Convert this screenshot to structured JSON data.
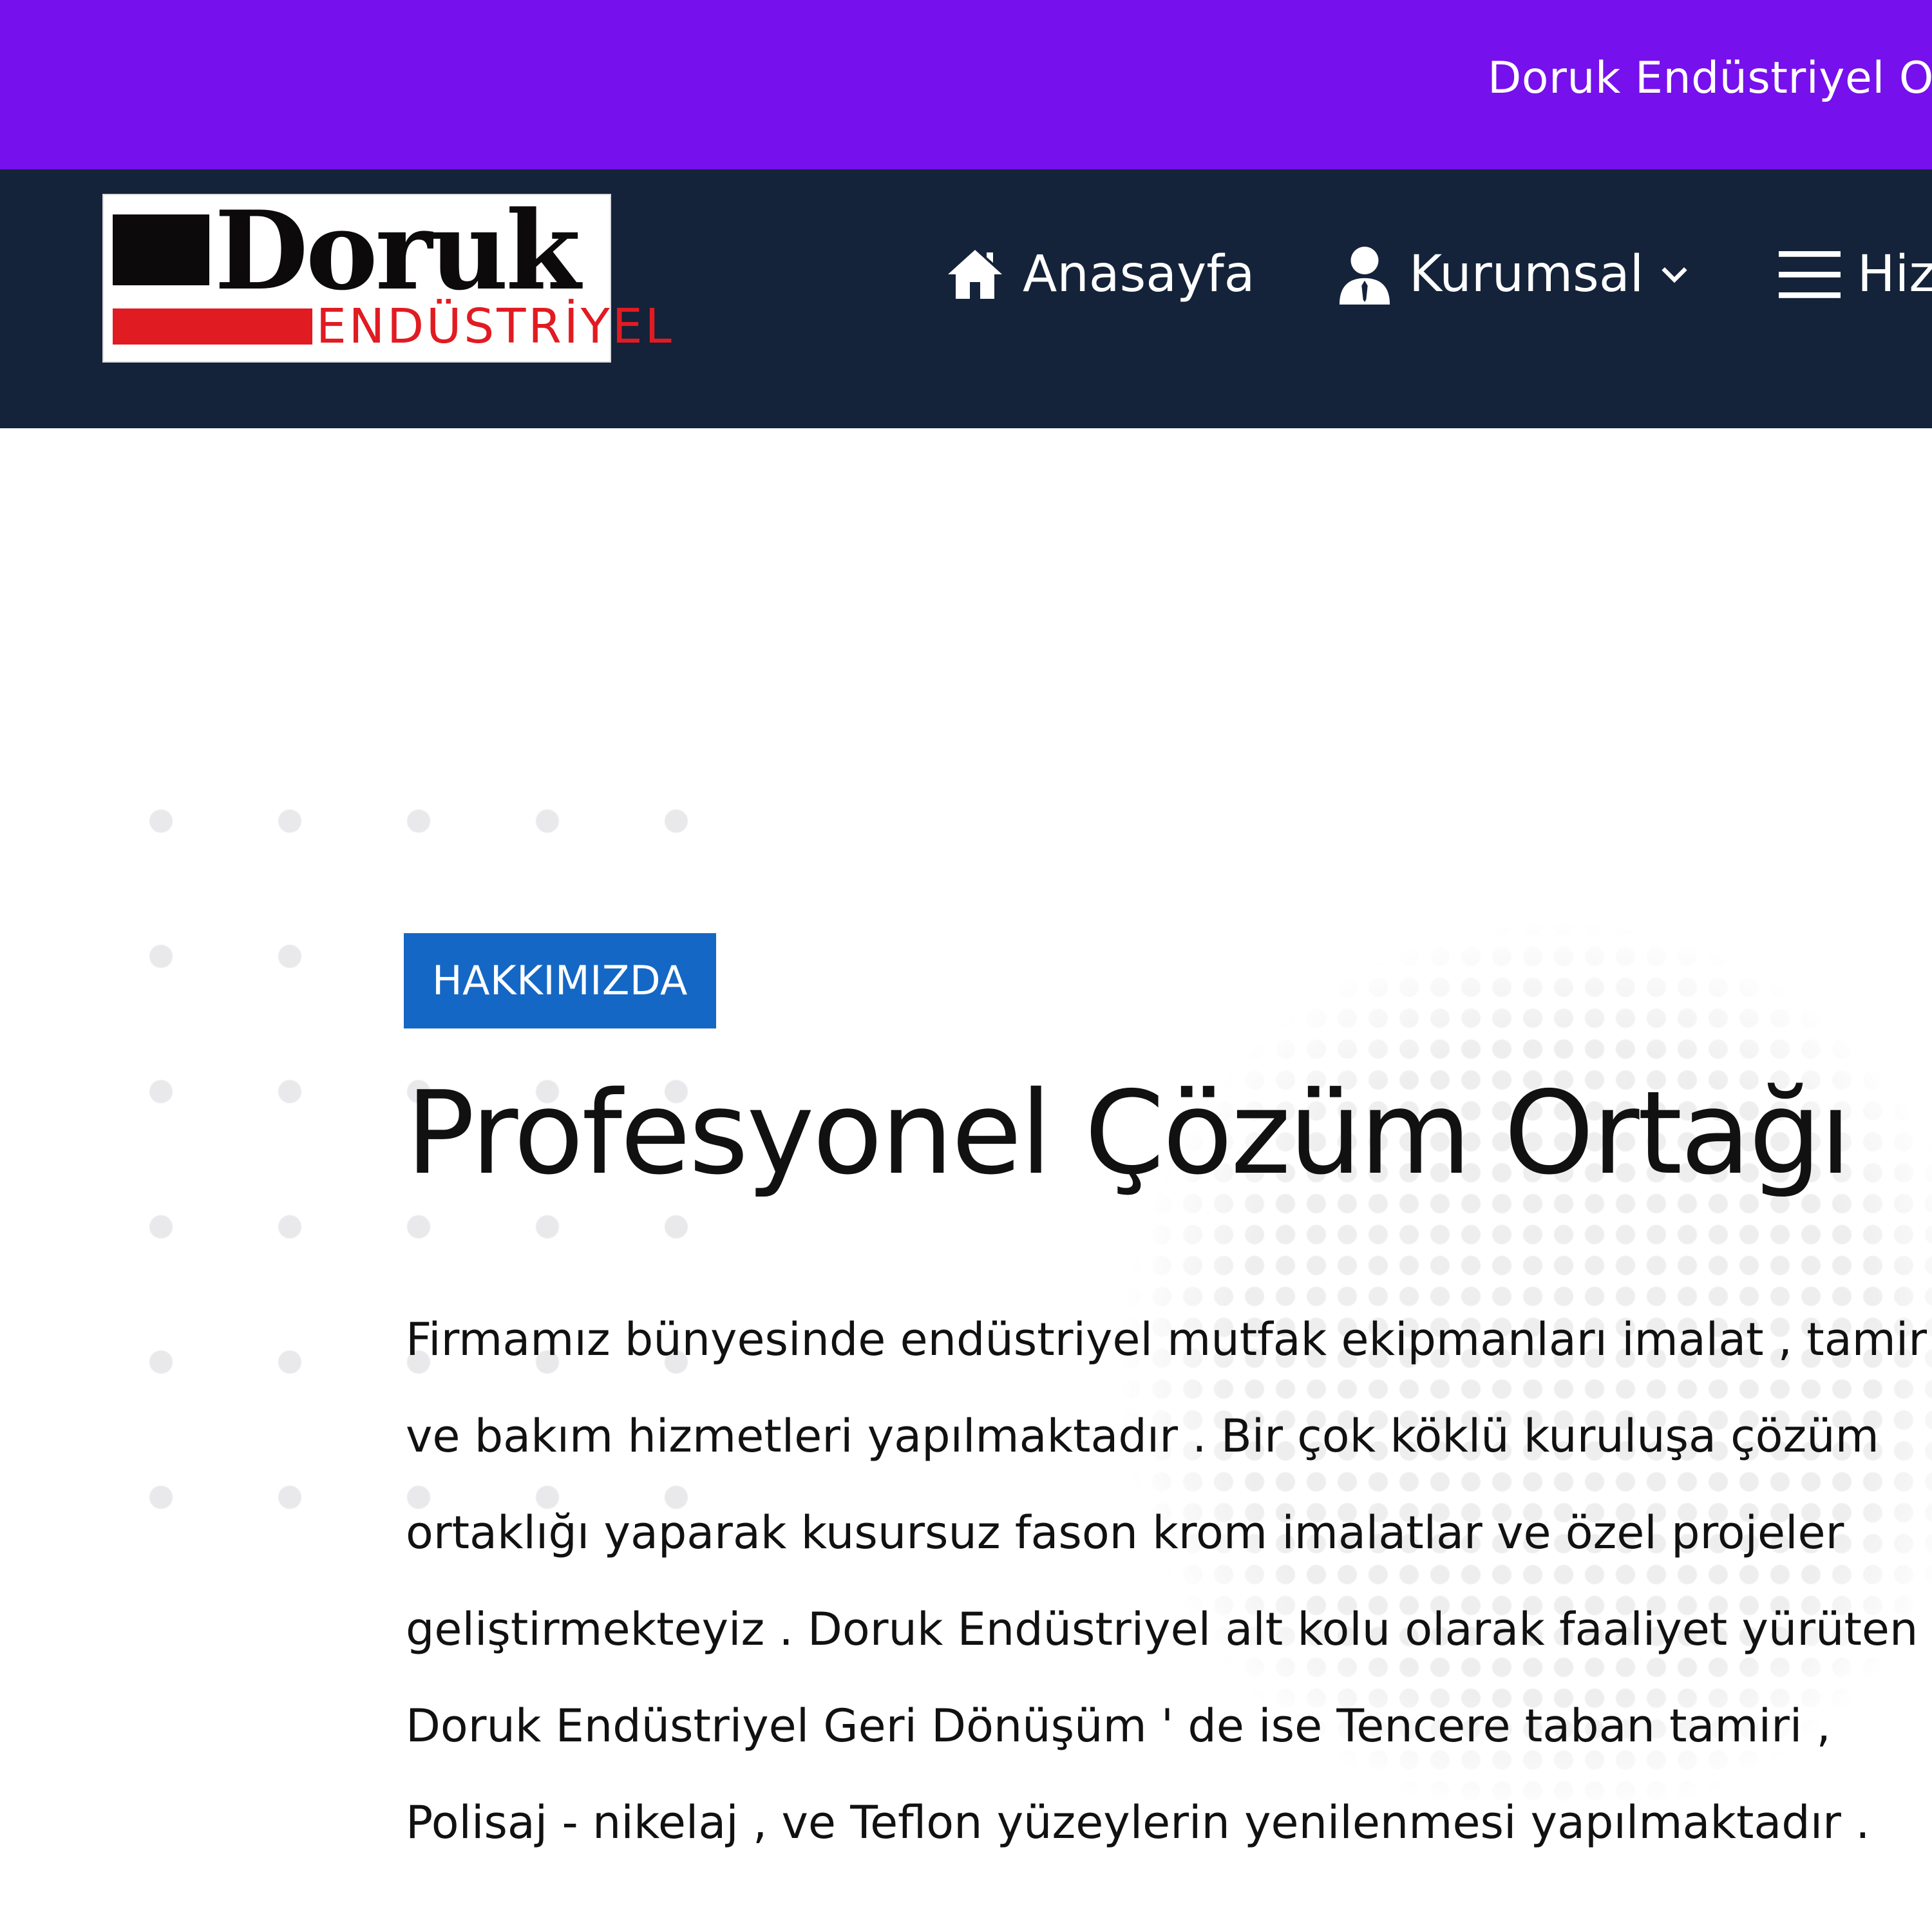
{
  "topbar": {
    "ticker_text": "Doruk Endüstriyel Ot"
  },
  "header": {
    "logo": {
      "word": "Doruk",
      "sub": "ENDÜSTRİYEL"
    },
    "nav": [
      {
        "label": "Anasayfa",
        "icon": "home-icon"
      },
      {
        "label": "Kurumsal",
        "icon": "user-icon",
        "has_dropdown": true
      },
      {
        "label": "Hiz",
        "icon": "menu-icon"
      }
    ]
  },
  "about": {
    "badge": "HAKKIMIZDA",
    "title": "Profesyonel Çözüm Ortağı",
    "paragraph": "Firmamız bünyesinde endüstriyel mutfak ekipmanları imalat , tamir ve bakım hizmetleri yapılmaktadır . Bir çok köklü kuruluşa çözüm ortaklığı yaparak kusursuz fason krom imalatlar ve özel projeler geliştirmekteyiz . Doruk Endüstriyel alt kolu olarak faaliyet yürüten Doruk Endüstriyel Geri Dönüşüm ' de ise Tencere taban tamiri , Polisaj - nikelaj , ve Teflon yüzeylerin yenilenmesi yapılmaktadır ."
  },
  "colors": {
    "topbar": "#7610ec",
    "navbar": "#142339",
    "badge": "#1467c5",
    "logo_red": "#e11b22"
  }
}
